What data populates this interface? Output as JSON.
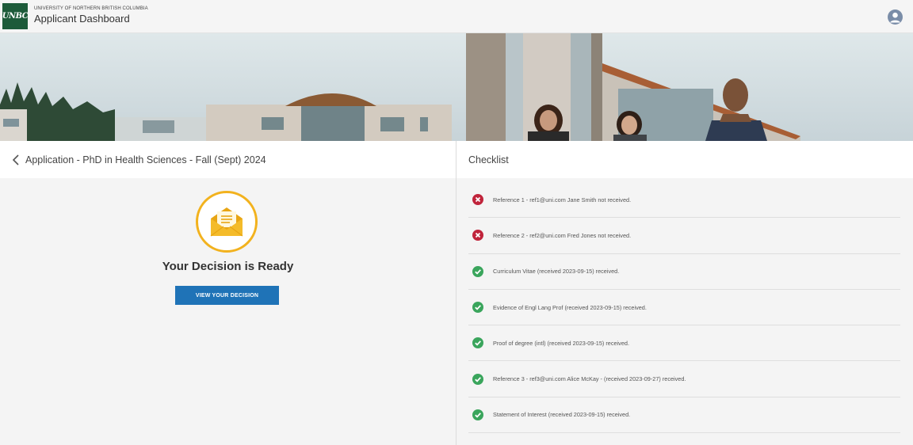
{
  "header": {
    "university": "UNIVERSITY OF NORTHERN BRITISH COLUMBIA",
    "title": "Applicant Dashboard",
    "logo_text": "UNBC",
    "profile_icon": "user-avatar-icon"
  },
  "application": {
    "title": "Application - PhD in Health Sciences - Fall (Sept) 2024",
    "decision_heading": "Your Decision is Ready",
    "view_button": "VIEW YOUR DECISION",
    "envelope_icon": "envelope-open-icon"
  },
  "checklist": {
    "title": "Checklist",
    "items": [
      {
        "status": "missing",
        "text": "Reference 1 - ref1@uni.com Jane Smith not received."
      },
      {
        "status": "missing",
        "text": "Reference 2 - ref2@uni.com Fred Jones not received."
      },
      {
        "status": "received",
        "text": "Curriculum Vitae (received 2023-09-15) received."
      },
      {
        "status": "received",
        "text": "Evidence of Engl Lang Prof (received 2023-09-15) received."
      },
      {
        "status": "received",
        "text": "Proof of degree (intl) (received 2023-09-15) received."
      },
      {
        "status": "received",
        "text": "Reference 3 - ref3@uni.com Alice McKay - (received 2023-09-27) received."
      },
      {
        "status": "received",
        "text": "Statement of Interest (received 2023-09-15) received."
      }
    ]
  },
  "colors": {
    "brand_green": "#1d5b3a",
    "button_blue": "#1f73b7",
    "gold": "#f2b21e",
    "error_red": "#c0243b",
    "success_green": "#3aa55c"
  }
}
